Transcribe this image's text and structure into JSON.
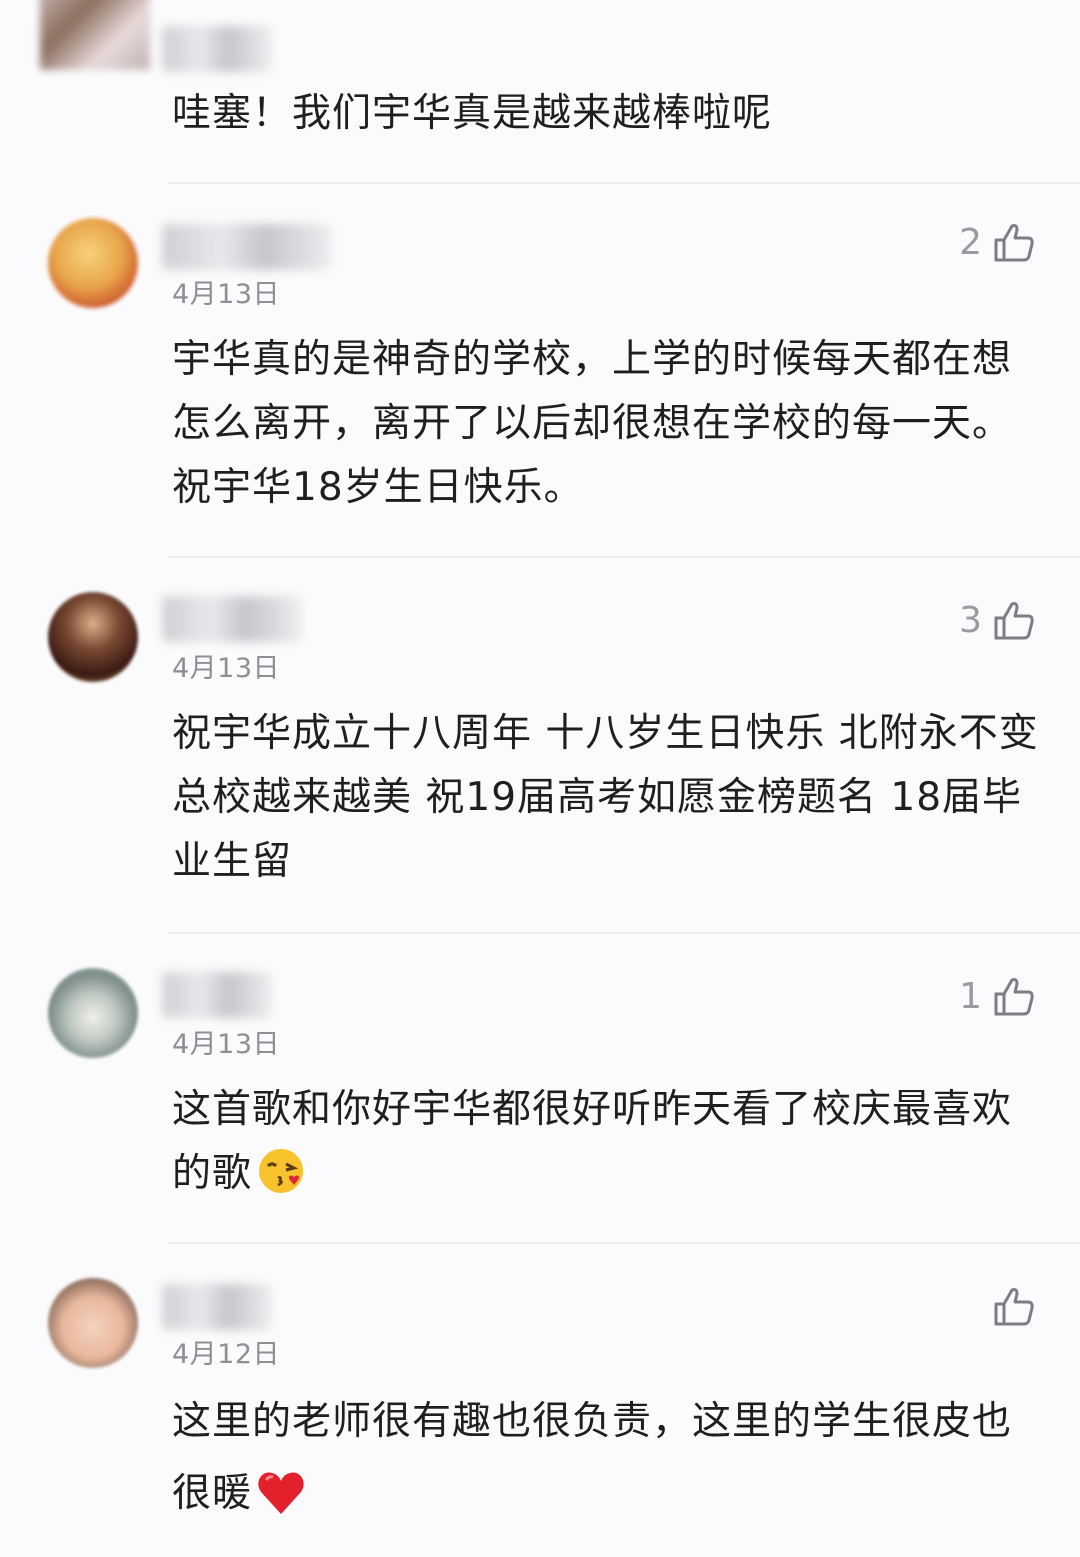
{
  "comments": [
    {
      "text": "哇塞！我们宇华真是越来越棒啦呢"
    },
    {
      "date": "4月13日",
      "likes": "2",
      "text": "宇华真的是神奇的学校，上学的时候每天都在想怎么离开，离开了以后却很想在学校的每一天。祝宇华18岁生日快乐。"
    },
    {
      "date": "4月13日",
      "likes": "3",
      "text": "祝宇华成立十八周年 十八岁生日快乐 北附永不变 总校越来越美 祝19届高考如愿金榜题名 18届毕业生留"
    },
    {
      "date": "4月13日",
      "likes": "1",
      "text": "这首歌和你好宇华都很好听昨天看了校庆最喜欢的歌",
      "emoji": "kissing-heart-emoji"
    },
    {
      "date": "4月12日",
      "likes": "",
      "text": "这里的老师很有趣也很负责，这里的学生很皮也很暖",
      "emoji": "red-heart-emoji"
    }
  ],
  "icons": {
    "like": "thumbs-up-icon"
  },
  "colors": {
    "background": "#fbfbfd",
    "text": "#1f1f1f",
    "meta": "#8e8e93",
    "divider": "#ececef"
  }
}
